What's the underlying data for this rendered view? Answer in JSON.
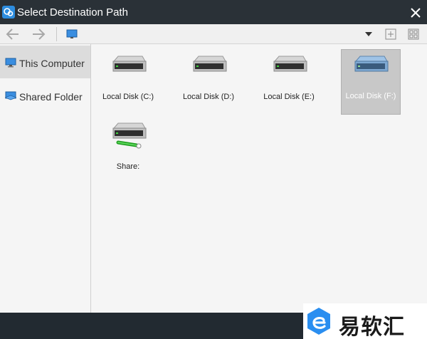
{
  "window": {
    "title": "Select Destination Path"
  },
  "toolbar": {
    "back_icon": "arrow-left-icon",
    "forward_icon": "arrow-right-icon",
    "location_icon": "computer-icon",
    "dropdown_icon": "triangle-down-icon",
    "new_folder_icon": "plus-square-icon",
    "view_icon": "grid-view-icon"
  },
  "sidebar": {
    "items": [
      {
        "label": "This Computer",
        "icon": "computer-icon",
        "selected": true
      },
      {
        "label": "Shared Folder",
        "icon": "shared-folder-icon",
        "selected": false
      }
    ]
  },
  "main": {
    "items": [
      {
        "label": "Local Disk (C:)",
        "icon": "hard-drive-icon",
        "selected": false
      },
      {
        "label": "Local Disk (D:)",
        "icon": "hard-drive-icon",
        "selected": false
      },
      {
        "label": "Local Disk (E:)",
        "icon": "hard-drive-icon",
        "selected": false
      },
      {
        "label": "Local Disk (F:)",
        "icon": "hard-drive-icon",
        "selected": true
      },
      {
        "label": "Share:",
        "icon": "network-drive-icon",
        "selected": false
      }
    ]
  },
  "watermark": {
    "text": "易软汇",
    "icon": "e-logo-icon"
  },
  "colors": {
    "titlebar": "#2a3137",
    "accent": "#2d8ddf",
    "selected_tile": "#c8c8c8",
    "pane_bg": "#f5f5f5"
  }
}
